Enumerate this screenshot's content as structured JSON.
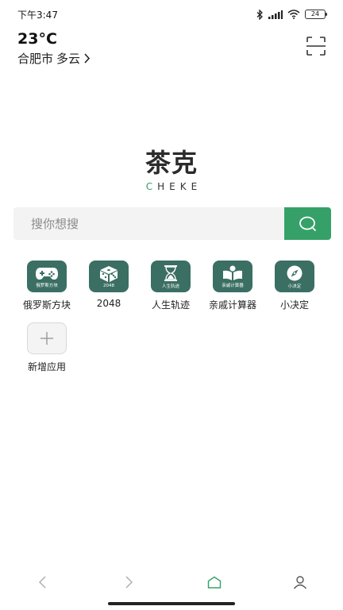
{
  "status_bar": {
    "time": "下午3:47",
    "battery": "24"
  },
  "weather": {
    "temperature": "23°C",
    "location": "合肥市",
    "condition": "多云"
  },
  "logo": {
    "title": "茶克",
    "subtitle_first": "C",
    "subtitle_rest": "HEKE"
  },
  "search": {
    "placeholder": "搜你想搜"
  },
  "apps": [
    {
      "label": "俄罗斯方块",
      "icon_caption": "俄罗斯方块",
      "icon": "gamepad-icon"
    },
    {
      "label": "2048",
      "icon_caption": "2048",
      "icon": "dice-icon"
    },
    {
      "label": "人生轨迹",
      "icon_caption": "人生轨迹",
      "icon": "hourglass-icon"
    },
    {
      "label": "亲戚计算器",
      "icon_caption": "亲戚计算器",
      "icon": "reading-icon"
    },
    {
      "label": "小决定",
      "icon_caption": "小决定",
      "icon": "compass-icon"
    }
  ],
  "add_app": {
    "label": "新增应用"
  },
  "colors": {
    "accent": "#35a168",
    "app_icon_bg": "#3b6f63"
  }
}
